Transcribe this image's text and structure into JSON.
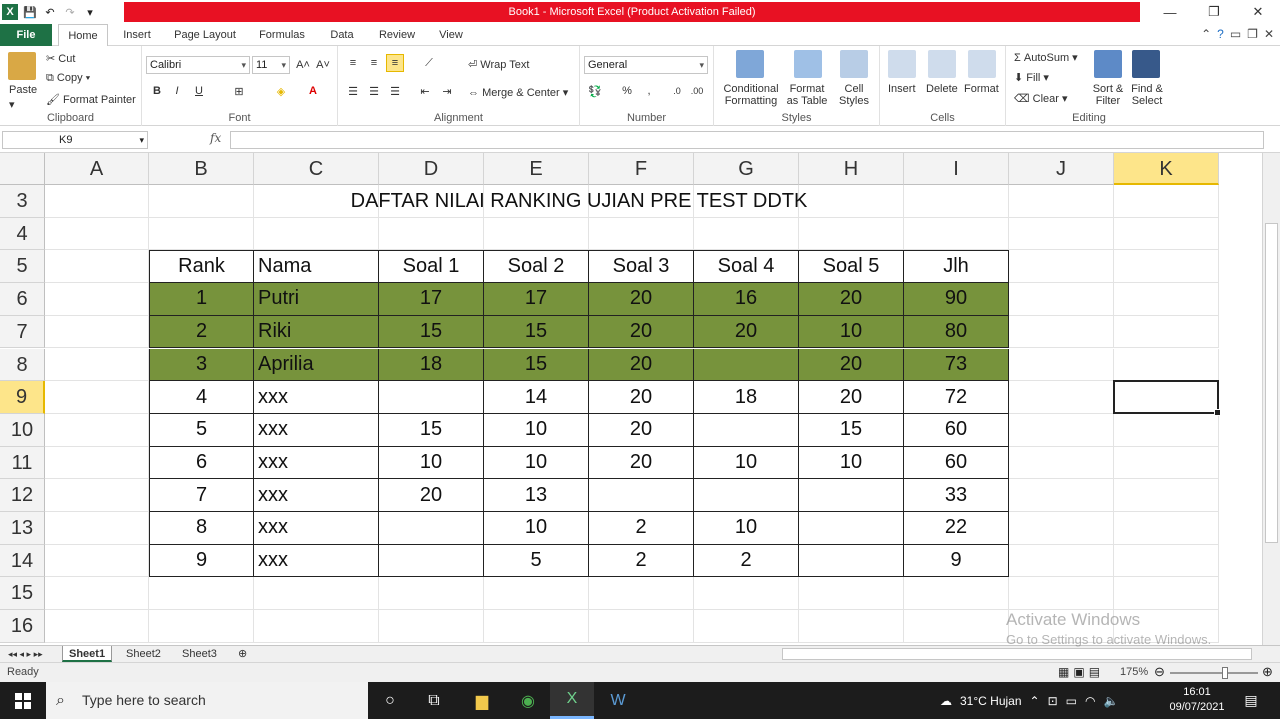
{
  "window": {
    "title": "Book1  -  Microsoft Excel (Product Activation Failed)"
  },
  "ribbon_tabs": [
    "File",
    "Home",
    "Insert",
    "Page Layout",
    "Formulas",
    "Data",
    "Review",
    "View"
  ],
  "clipboard": {
    "paste": "Paste",
    "cut": "Cut",
    "copy": "Copy",
    "format_painter": "Format Painter",
    "label": "Clipboard"
  },
  "font": {
    "name": "Calibri",
    "size": "11",
    "label": "Font"
  },
  "alignment": {
    "wrap_text": "Wrap Text",
    "merge_center": "Merge & Center",
    "label": "Alignment"
  },
  "number": {
    "format": "General",
    "label": "Number"
  },
  "styles": {
    "conditional_formatting": [
      "Conditional",
      "Formatting"
    ],
    "format_as_table": [
      "Format",
      "as Table"
    ],
    "cell_styles": [
      "Cell",
      "Styles"
    ],
    "label": "Styles"
  },
  "cells_group": {
    "insert": "Insert",
    "delete": "Delete",
    "format": "Format",
    "label": "Cells"
  },
  "editing": {
    "autosum": "AutoSum",
    "fill": "Fill",
    "clear": "Clear",
    "sort_filter": [
      "Sort &",
      "Filter"
    ],
    "find_select": [
      "Find &",
      "Select"
    ],
    "label": "Editing"
  },
  "formula_bar": {
    "name_box": "K9",
    "fx": "fx",
    "value": ""
  },
  "columns": [
    "A",
    "B",
    "C",
    "D",
    "E",
    "F",
    "G",
    "H",
    "I",
    "J",
    "K"
  ],
  "selected_column": "K",
  "rows": [
    "3",
    "4",
    "5",
    "6",
    "7",
    "8",
    "9",
    "10",
    "11",
    "12",
    "13",
    "14",
    "15",
    "16"
  ],
  "selected_row": "9",
  "sheet": {
    "title": "DAFTAR NILAI RANKING UJIAN PRE TEST DDTK",
    "headers": [
      "Rank",
      "Nama",
      "Soal 1",
      "Soal 2",
      "Soal 3",
      "Soal 4",
      "Soal 5",
      "Jlh"
    ],
    "data": [
      [
        "1",
        "Putri",
        "17",
        "17",
        "20",
        "16",
        "20",
        "90"
      ],
      [
        "2",
        "Riki",
        "15",
        "15",
        "20",
        "20",
        "10",
        "80"
      ],
      [
        "3",
        "Aprilia",
        "18",
        "15",
        "20",
        "",
        "20",
        "73"
      ],
      [
        "4",
        "xxx",
        "",
        "14",
        "20",
        "18",
        "20",
        "72"
      ],
      [
        "5",
        "xxx",
        "15",
        "10",
        "20",
        "",
        "15",
        "60"
      ],
      [
        "6",
        "xxx",
        "10",
        "10",
        "20",
        "10",
        "10",
        "60"
      ],
      [
        "7",
        "xxx",
        "20",
        "13",
        "",
        "",
        "",
        "33"
      ],
      [
        "8",
        "xxx",
        "",
        "10",
        "2",
        "10",
        "",
        "22"
      ],
      [
        "9",
        "xxx",
        "",
        "5",
        "2",
        "2",
        "",
        "9"
      ]
    ],
    "highlight_color": "#77933c"
  },
  "sheet_tabs": [
    "Sheet1",
    "Sheet2",
    "Sheet3"
  ],
  "status": {
    "ready": "Ready",
    "zoom": "175%"
  },
  "watermark": {
    "line1": "Activate Windows",
    "line2": "Go to Settings to activate Windows."
  },
  "taskbar": {
    "search_placeholder": "Type here to search",
    "weather": "31°C  Hujan",
    "time": "16:01",
    "date": "09/07/2021"
  },
  "colors": {
    "excel_green": "#1e7145",
    "title_red": "#e81123",
    "selection_yellow": "#fde58a"
  }
}
